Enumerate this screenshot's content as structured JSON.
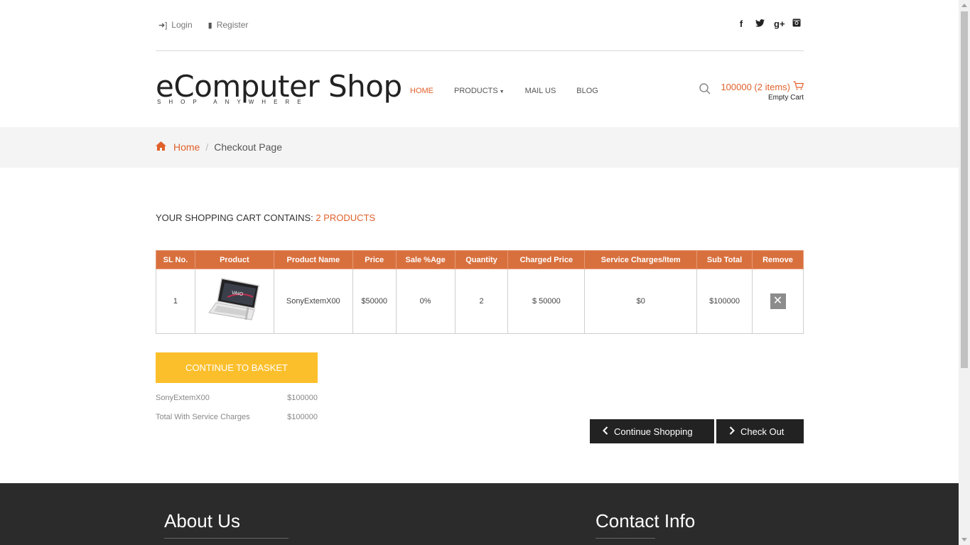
{
  "topbar": {
    "login": "Login",
    "register": "Register",
    "social": [
      "f",
      "t",
      "g+",
      "ig"
    ]
  },
  "brand": {
    "name": "eComputer Shop",
    "tagline": "SHOP ANYWHERE"
  },
  "nav": {
    "home": "HOME",
    "products": "PRODUCTS",
    "mail": "MAIL US",
    "blog": "BLOG"
  },
  "cart_summary": {
    "amount": "100000 (2 items)",
    "empty": "Empty Cart"
  },
  "breadcrumb": {
    "home": "Home",
    "current": "Checkout Page"
  },
  "cart_heading": {
    "label": "YOUR SHOPPING CART CONTAINS:",
    "count": "2 PRODUCTS"
  },
  "table": {
    "headers": [
      "SL No.",
      "Product",
      "Product Name",
      "Price",
      "Sale %Age",
      "Quantity",
      "Charged Price",
      "Service Charges/Item",
      "Sub Total",
      "Remove"
    ],
    "rows": [
      {
        "sl": "1",
        "name": "SonyExtemX00",
        "price": "$50000",
        "sale": "0%",
        "qty": "2",
        "charged": "$ 50000",
        "service": "$0",
        "subtotal": "$100000",
        "remove": "✕"
      }
    ]
  },
  "basket_button": "CONTINUE TO BASKET",
  "summary": [
    {
      "label": "SonyExtemX00",
      "value": "$100000"
    },
    {
      "label": "Total With Service Charges",
      "value": "$100000"
    }
  ],
  "actions": {
    "continue": "Continue Shopping",
    "checkout": "Check Out"
  },
  "footer": {
    "about": "About Us",
    "contact": "Contact Info"
  },
  "colors": {
    "accent": "#e0612b",
    "table_header": "#d8703e",
    "basket": "#fcbf2c",
    "footer": "#2b2b2b"
  }
}
